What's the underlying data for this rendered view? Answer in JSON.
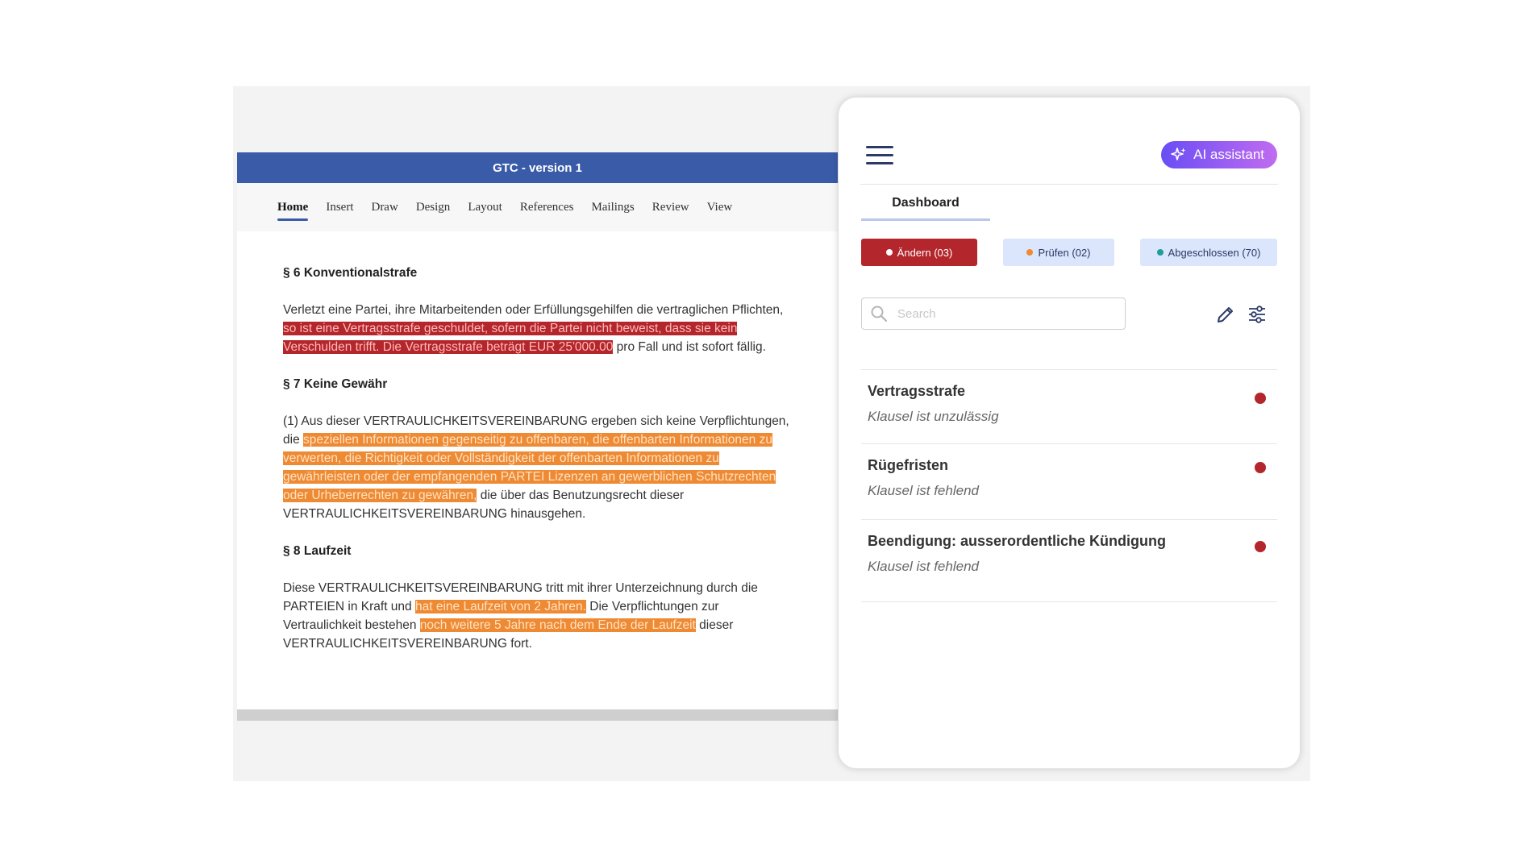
{
  "document": {
    "title": "GTC - version 1",
    "ribbon_tabs": [
      "Home",
      "Insert",
      "Draw",
      "Design",
      "Layout",
      "References",
      "Mailings",
      "Review",
      "View"
    ],
    "active_tab": "Home",
    "sections": {
      "s6": {
        "heading": "§ 6 Konventionalstrafe",
        "text_before": "Verletzt eine Partei, ihre Mitarbeitenden oder Erfüllungsgehilfen die vertraglichen Pflichten,",
        "highlight": "so ist eine Vertragsstrafe geschuldet, sofern die Partei nicht beweist, dass sie kein Verschulden trifft. Die Vertragsstrafe beträgt EUR 25'000.00",
        "text_after": "pro Fall und ist sofort fällig."
      },
      "s7": {
        "heading": "§ 7 Keine Gewähr",
        "text_before": "(1) Aus dieser VERTRAULICHKEITSVEREINBARUNG ergeben sich keine Verpflichtungen, die",
        "highlight": "speziellen Informationen gegenseitig zu offenbaren, die offenbarten Informationen zu verwerten, die Richtigkeit oder Vollständigkeit der offenbarten Informationen zu gewährleisten oder der empfangenden PARTEI Lizenzen an gewerblichen Schutzrechten oder Urheberrechten zu gewähren,",
        "text_after": "die über das Benutzungsrecht dieser VERTRAULICHKEITSVEREINBARUNG hinausgehen."
      },
      "s8": {
        "heading": "§ 8 Laufzeit",
        "text_before": "Diese VERTRAULICHKEITSVEREINBARUNG tritt mit ihrer Unterzeichnung durch die PARTEIEN in Kraft und",
        "highlight1": "hat eine Laufzeit von 2 Jahren.",
        "text_middle": "Die Verpflichtungen zur Vertraulichkeit bestehen",
        "highlight2": "noch weitere 5 Jahre nach dem Ende der Laufzeit",
        "text_after": "dieser VERTRAULICHKEITSVEREINBARUNG fort."
      }
    }
  },
  "panel": {
    "ai_button": "AI assistant",
    "tab": "Dashboard",
    "filters": [
      {
        "label": "Ändern (03)",
        "dot": "#ffffff"
      },
      {
        "label": "Prüfen (02)",
        "dot": "#ee8a33"
      },
      {
        "label": "Abgeschlossen (70)",
        "dot": "#1f9d9a"
      }
    ],
    "search_placeholder": "Search",
    "items": [
      {
        "title": "Vertragsstrafe",
        "subtitle": "Klausel ist unzulässig"
      },
      {
        "title": "Rügefristen",
        "subtitle": "Klausel ist fehlend"
      },
      {
        "title": "Beendigung: ausserordentliche Kündigung",
        "subtitle": "Klausel ist fehlend"
      }
    ]
  },
  "colors": {
    "titlebar": "#3a5ba8",
    "highlight_red": "#b3262b",
    "highlight_orange": "#ee8a33",
    "status_red": "#b3262b"
  }
}
